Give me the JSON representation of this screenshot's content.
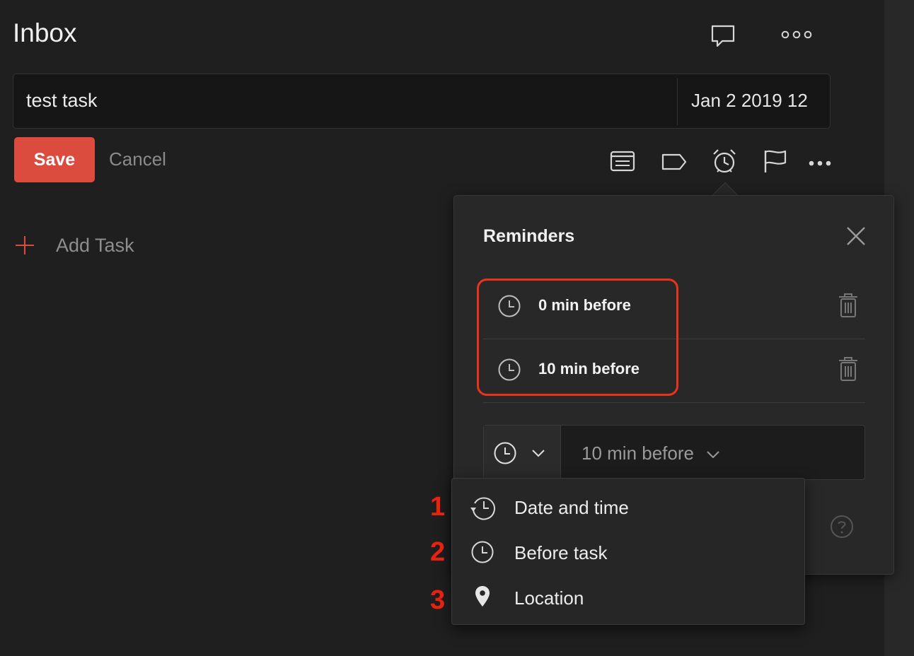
{
  "header": {
    "title": "Inbox",
    "icons": [
      "comment-icon",
      "more-horizontal-icon"
    ]
  },
  "task_editor": {
    "task_text": "test task",
    "due_date": "Jan 2 2019 12",
    "save_label": "Save",
    "cancel_label": "Cancel",
    "toolbar_icons": [
      "project-icon",
      "label-icon",
      "alarm-icon",
      "flag-icon",
      "more-icon"
    ]
  },
  "add_task": {
    "label": "Add Task"
  },
  "reminders_popup": {
    "title": "Reminders",
    "reminders": [
      {
        "label": "0 min before",
        "icon": "clock-icon"
      },
      {
        "label": "10 min before",
        "icon": "clock-icon"
      }
    ],
    "new_reminder": {
      "type_icon": "clock-icon",
      "value": "10 min before"
    }
  },
  "type_menu": {
    "items": [
      {
        "label": "Date and time",
        "icon": "history-clock-icon"
      },
      {
        "label": "Before task",
        "icon": "clock-icon"
      },
      {
        "label": "Location",
        "icon": "location-pin-icon"
      }
    ]
  },
  "annotations": {
    "markers": [
      "1",
      "2",
      "3"
    ],
    "highlight_color": "#e8341d"
  },
  "colors": {
    "background": "#1f1f1f",
    "accent": "#dc4c3e",
    "popup": "#282828"
  }
}
